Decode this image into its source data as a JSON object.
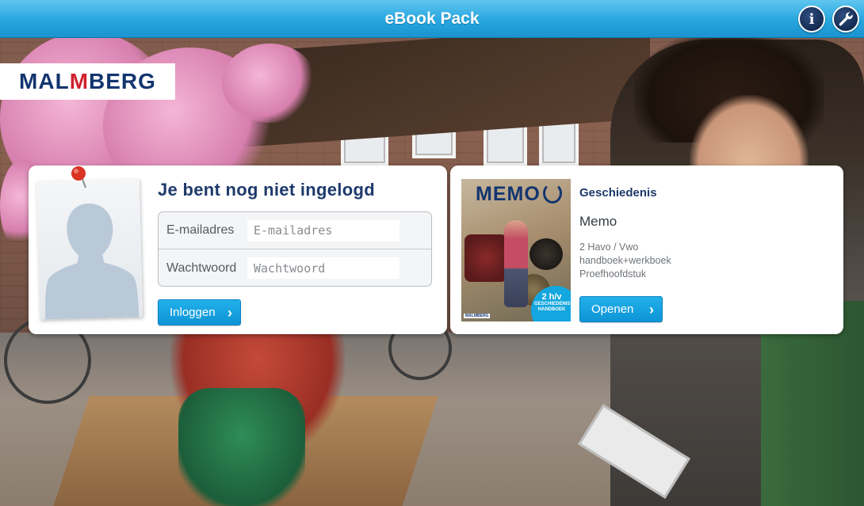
{
  "header": {
    "title": "eBook Pack",
    "info_button_icon": "info-icon",
    "settings_button_icon": "wrench-icon"
  },
  "brand": {
    "logo_text_left": "MAL",
    "logo_text_mark": "M",
    "logo_text_right": "BERG",
    "logo_color": "#12356f",
    "logo_mark_color": "#d0212f"
  },
  "login": {
    "title": "Je bent nog niet ingelogd",
    "email_label": "E-mailadres",
    "email_placeholder": "E-mailadres",
    "email_value": "",
    "password_label": "Wachtwoord",
    "password_placeholder": "Wachtwoord",
    "password_value": "",
    "submit_label": "Inloggen",
    "avatar_icon": "user-silhouette-icon",
    "pin_icon": "pushpin-icon"
  },
  "book": {
    "cover_title": "MEMO",
    "cover_badge_level": "2 h/v",
    "cover_badge_subject": "GESCHIEDENIS",
    "cover_badge_type": "HANDBOEK",
    "cover_publisher": "MALMBERG",
    "subject": "Geschiedenis",
    "title": "Memo",
    "level": "2 Havo / Vwo",
    "edition": "handboek+werkboek",
    "chapter": "Proefhoofdstuk",
    "open_label": "Openen"
  },
  "colors": {
    "accent": "#1b9ad6",
    "header_dark": "#12284d",
    "heading": "#1d3a6b"
  }
}
